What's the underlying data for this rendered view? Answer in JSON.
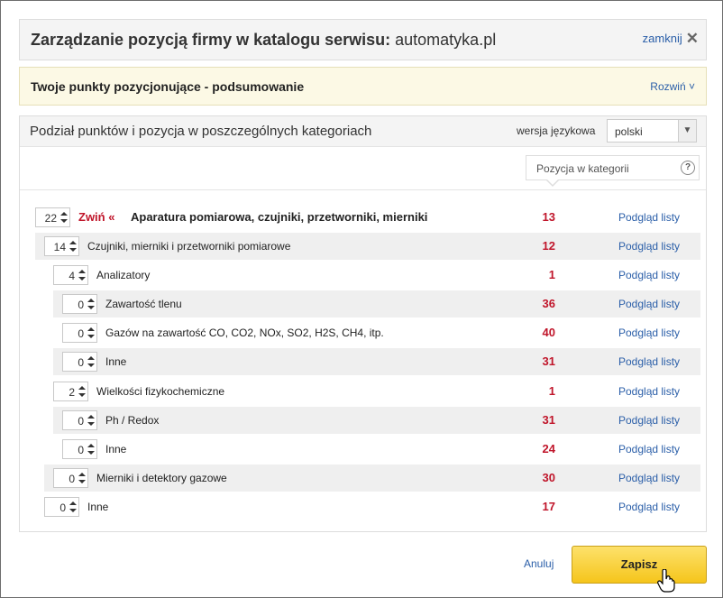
{
  "header": {
    "title_bold": "Zarządzanie pozycją firmy w katalogu serwisu:",
    "title_host": "automatyka.pl",
    "close_label": "zamknij",
    "close_icon": "close-icon"
  },
  "summary": {
    "title": "Twoje punkty pozycjonujące - podsumowanie",
    "expand_label": "Rozwiń"
  },
  "panel": {
    "title": "Podział punktów i pozycja w poszczególnych kategoriach",
    "language_label": "wersja językowa",
    "language_value": "polski",
    "position_header": "Pozycja w kategorii",
    "help_glyph": "?"
  },
  "rows": [
    {
      "points": "22",
      "collapse": "Zwiń «",
      "name": "Aparatura pomiarowa, czujniki, przetworniki, mierniki",
      "score": "13",
      "preview": "Podgląd listy"
    },
    {
      "points": "14",
      "name": "Czujniki, mierniki i przetworniki pomiarowe",
      "score": "12",
      "preview": "Podgląd listy"
    },
    {
      "points": "4",
      "name": "Analizatory",
      "score": "1",
      "preview": "Podgląd listy"
    },
    {
      "points": "0",
      "name": "Zawartość tlenu",
      "score": "36",
      "preview": "Podgląd listy"
    },
    {
      "points": "0",
      "name": "Gazów na zawartość CO, CO2, NOx, SO2, H2S, CH4, itp.",
      "score": "40",
      "preview": "Podgląd listy"
    },
    {
      "points": "0",
      "name": "Inne",
      "score": "31",
      "preview": "Podgląd listy"
    },
    {
      "points": "2",
      "name": "Wielkości fizykochemiczne",
      "score": "1",
      "preview": "Podgląd listy"
    },
    {
      "points": "0",
      "name": "Ph / Redox",
      "score": "31",
      "preview": "Podgląd listy"
    },
    {
      "points": "0",
      "name": "Inne",
      "score": "24",
      "preview": "Podgląd listy"
    },
    {
      "points": "0",
      "name": "Mierniki i detektory gazowe",
      "score": "30",
      "preview": "Podgląd listy"
    },
    {
      "points": "0",
      "name": "Inne",
      "score": "17",
      "preview": "Podgląd listy"
    }
  ],
  "footer": {
    "cancel_label": "Anuluj",
    "save_label": "Zapisz"
  },
  "colors": {
    "accent_red": "#c0152a",
    "link_blue": "#2a5ea8",
    "save_yellow": "#f5c51b"
  }
}
